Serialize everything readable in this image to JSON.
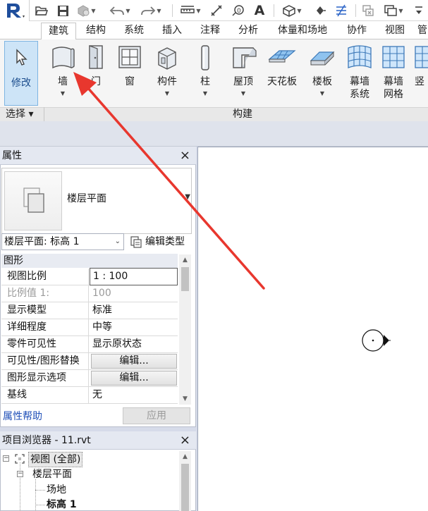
{
  "ribbon": {
    "tabs": [
      {
        "label": "建筑",
        "active": true
      },
      {
        "label": "结构"
      },
      {
        "label": "系统"
      },
      {
        "label": "插入"
      },
      {
        "label": "注释"
      },
      {
        "label": "分析"
      },
      {
        "label": "体量和场地"
      },
      {
        "label": "协作"
      },
      {
        "label": "视图"
      },
      {
        "label": "管"
      }
    ],
    "tools": {
      "modify": "修改",
      "wall": "墙",
      "door": "门",
      "window": "窗",
      "component": "构件",
      "column": "柱",
      "roof": "屋顶",
      "ceiling": "天花板",
      "floor": "楼板",
      "curtain_system": [
        "幕墙",
        "系统"
      ],
      "curtain_grid": [
        "幕墙",
        "网格"
      ],
      "vertical": "竖"
    },
    "panels": {
      "select": "选择 ▾",
      "build": "构建"
    }
  },
  "properties": {
    "title": "属性",
    "close": "×",
    "type_name": "楼层平面",
    "instance_selector": "楼层平面: 标高 1",
    "edit_type": "编辑类型",
    "group": "图形",
    "rows": [
      {
        "name": "视图比例",
        "value": "1 : 100"
      },
      {
        "name": "比例值 1:",
        "value": "100"
      },
      {
        "name": "显示模型",
        "value": "标准"
      },
      {
        "name": "详细程度",
        "value": "中等"
      },
      {
        "name": "零件可见性",
        "value": "显示原状态"
      },
      {
        "name": "可见性/图形替换",
        "value": "编辑..."
      },
      {
        "name": "图形显示选项",
        "value": "编辑..."
      },
      {
        "name": "基线",
        "value": "无"
      }
    ],
    "help": "属性帮助",
    "apply": "应用"
  },
  "browser": {
    "title": "项目浏览器 - 11.rvt",
    "close": "×",
    "nodes": [
      {
        "label": "视图 (全部)",
        "expander": "−"
      },
      {
        "label": "楼层平面",
        "expander": "−"
      },
      {
        "label": "场地"
      },
      {
        "label": "标高 1"
      }
    ]
  },
  "colors": {
    "arrow": "#e8372e",
    "app_blue": "#1f4e9c",
    "link": "#1f4fb8"
  }
}
